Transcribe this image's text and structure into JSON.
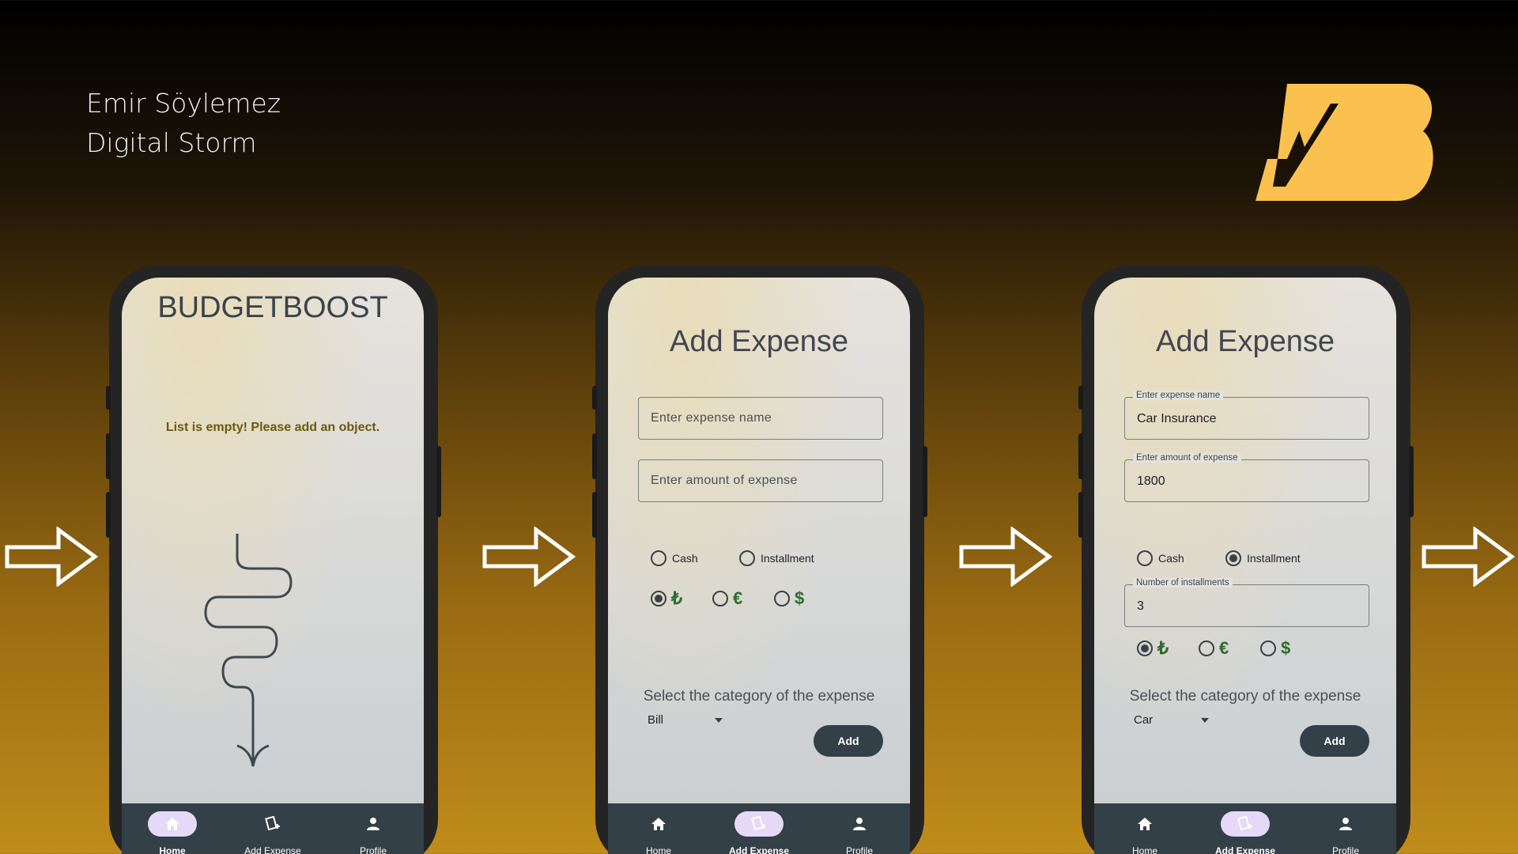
{
  "header": {
    "author_name": "Emir Söylemez",
    "author_team": "Digital Storm"
  },
  "logo": {
    "icon": "budgetboost-logo",
    "color": "#fbc14e"
  },
  "colors": {
    "nav_bg": "#334047",
    "active_pill": "#e5d9f7",
    "accent_text": "#6b5a0c",
    "currency_green": "#2e6b2e"
  },
  "nav": {
    "home": "Home",
    "add": "Add Expense",
    "profile": "Profile"
  },
  "screen1": {
    "app_title": "BUDGETBOOST",
    "empty_message": "List is empty! Please add an object."
  },
  "screen2": {
    "title": "Add Expense",
    "name_placeholder": "Enter expense name",
    "amount_placeholder": "Enter amount of expense",
    "radio_cash": "Cash",
    "radio_installment": "Installment",
    "currencies": [
      "₺",
      "€",
      "$"
    ],
    "category_title": "Select the category of the expense",
    "category_value": "Bill",
    "add_button": "Add"
  },
  "screen3": {
    "title": "Add Expense",
    "name_label": "Enter expense name",
    "name_value": "Car Insurance",
    "amount_label": "Enter amount of expense",
    "amount_value": "1800",
    "radio_cash": "Cash",
    "radio_installment": "Installment",
    "installments_label": "Number of installments",
    "installments_value": "3",
    "currencies": [
      "₺",
      "€",
      "$"
    ],
    "category_title": "Select the category of the expense",
    "category_value": "Car",
    "add_button": "Add"
  }
}
